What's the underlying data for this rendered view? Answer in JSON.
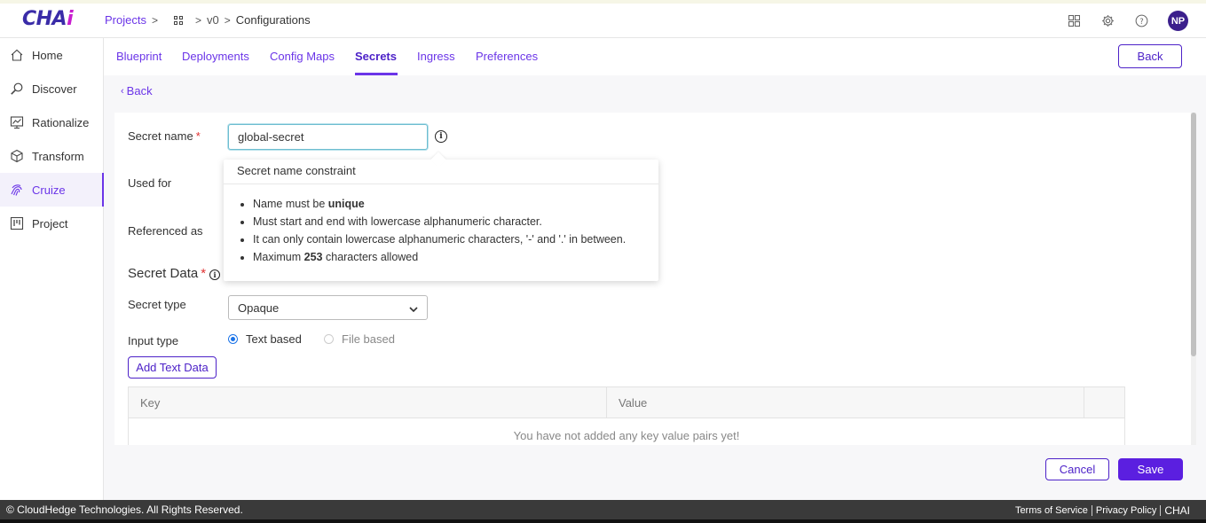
{
  "brand": {
    "logo_main": "CHA",
    "logo_accent": "i",
    "accent_color": "#6b35e8",
    "avatar_initials": "NP"
  },
  "breadcrumb": {
    "projects": "Projects",
    "grid_icon": "grid-icon",
    "version": "v0",
    "current": "Configurations"
  },
  "header_icons": [
    "apps-icon",
    "gear-icon",
    "help-icon"
  ],
  "sidebar": {
    "items": [
      {
        "label": "Home",
        "icon": "home-icon"
      },
      {
        "label": "Discover",
        "icon": "discover-icon"
      },
      {
        "label": "Rationalize",
        "icon": "rationalize-icon"
      },
      {
        "label": "Transform",
        "icon": "cube-icon"
      },
      {
        "label": "Cruize",
        "icon": "fingerprint-icon",
        "active": true
      },
      {
        "label": "Project",
        "icon": "project-icon"
      }
    ]
  },
  "tabs": [
    "Blueprint",
    "Deployments",
    "Config Maps",
    "Secrets",
    "Ingress",
    "Preferences"
  ],
  "active_tab": "Secrets",
  "top_back_button": "Back",
  "back_link": "Back",
  "form": {
    "secret_name_label": "Secret name",
    "required_mark": "*",
    "secret_name_value": "global-secret",
    "used_for_label": "Used for",
    "referenced_as_label": "Referenced as",
    "secret_data_title": "Secret Data",
    "secret_type_label": "Secret type",
    "secret_type_value": "Opaque",
    "input_type_label": "Input type",
    "input_type_options": {
      "text": "Text based",
      "file": "File based"
    },
    "input_type_selected": "Text based",
    "add_text_data_button": "Add Text Data"
  },
  "table": {
    "columns": [
      "Key",
      "Value"
    ],
    "empty_message": "You have not added any key value pairs yet!"
  },
  "popover": {
    "title": "Secret name constraint",
    "line1_prefix": "Name must be ",
    "line1_bold": "unique",
    "line2": "Must start and end with lowercase alphanumeric character.",
    "line3": "It can only contain lowercase alphanumeric characters, '-' and '.' in between.",
    "line4_prefix": "Maximum ",
    "line4_bold": "253",
    "line4_suffix": " characters allowed"
  },
  "actions": {
    "cancel": "Cancel",
    "save": "Save"
  },
  "footer": {
    "copyright": "© CloudHedge Technologies. All Rights Reserved.",
    "terms": "Terms of Service",
    "privacy": "Privacy Policy",
    "brand": "CHAI"
  }
}
